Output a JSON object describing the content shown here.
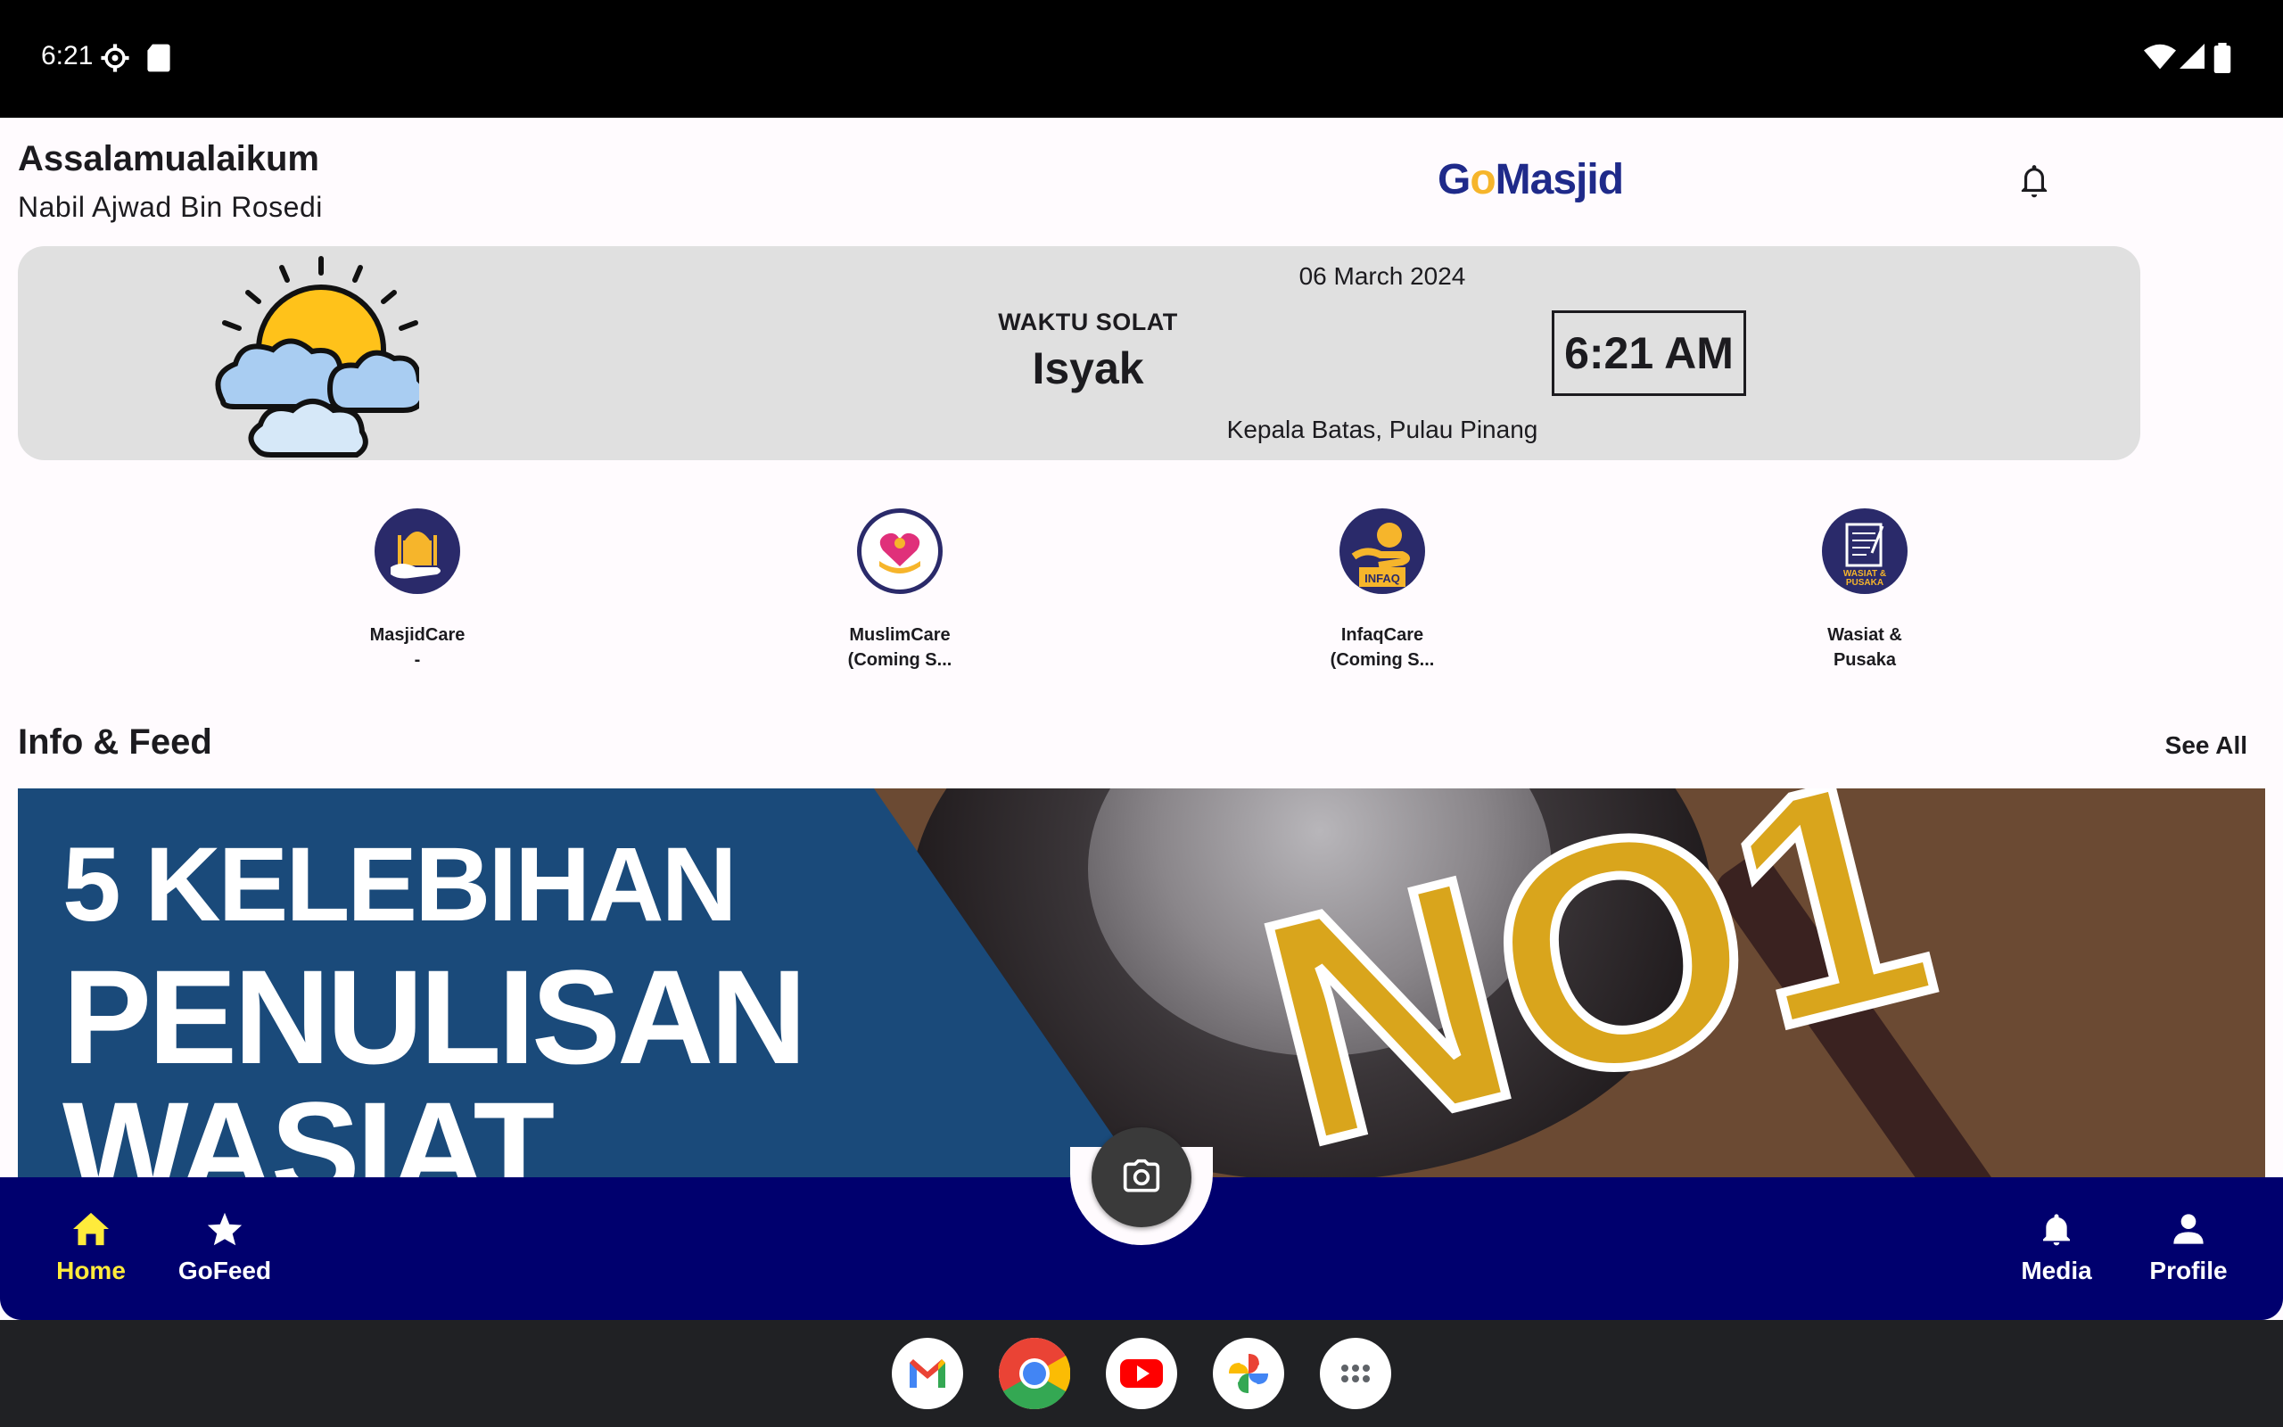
{
  "status_bar": {
    "time": "6:21",
    "icons": [
      "settings-icon",
      "sd-card-icon",
      "wifi-icon",
      "signal-icon",
      "battery-icon"
    ]
  },
  "header": {
    "greeting": "Assalamualaikum",
    "user_name": "Nabil Ajwad Bin Rosedi",
    "logo_text_a": "G",
    "logo_text_o": "o",
    "logo_text_b": "Masjid",
    "notification_icon": "bell-icon"
  },
  "prayer": {
    "date": "06 March 2024",
    "label": "WAKTU SOLAT",
    "name": "Isyak",
    "clock": "6:21 AM",
    "location": "Kepala Batas, Pulau Pinang"
  },
  "services": [
    {
      "line1": "MasjidCare",
      "line2": "-"
    },
    {
      "line1": "MuslimCare",
      "line2": "(Coming S..."
    },
    {
      "line1": "InfaqCare",
      "line2": "(Coming S..."
    },
    {
      "line1": "Wasiat &",
      "line2": "Pusaka"
    }
  ],
  "feed": {
    "title": "Info & Feed",
    "see_all": "See All",
    "banner": {
      "line1": "5 KELEBIHAN",
      "line2": "PENULISAN",
      "line3": "WASIAT",
      "badge": "NO1"
    }
  },
  "nav": {
    "home": "Home",
    "gofeed": "GoFeed",
    "media": "Media",
    "profile": "Profile"
  },
  "colors": {
    "nav_bg": "#00006e",
    "active": "#ffeb3b",
    "card_bg": "#e0e0e0"
  },
  "dock": [
    "gmail-icon",
    "chrome-icon",
    "youtube-icon",
    "photos-icon",
    "apps-icon"
  ]
}
